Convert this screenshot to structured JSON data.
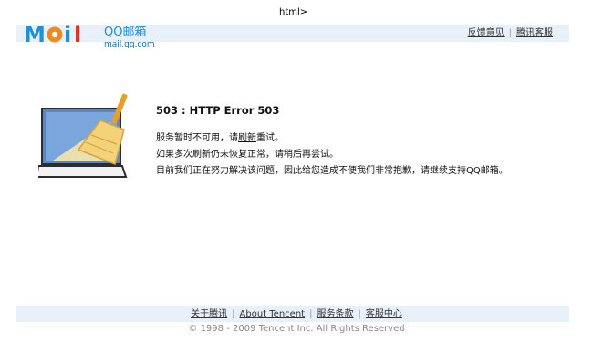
{
  "stray_text": "html>",
  "logo": {
    "word": "MOil",
    "product": "QQ邮箱",
    "domain": "mail.qq.com",
    "colors": {
      "blue": "#1f8fd6",
      "orange": "#f08a1c",
      "red": "#d9342b",
      "domain_text": "#1b6fae"
    }
  },
  "header_links": [
    {
      "label": "反馈意见"
    },
    {
      "label": "腾讯客服"
    }
  ],
  "error": {
    "title": "503 : HTTP Error 503",
    "line1_prefix": "服务暂时不可用，请",
    "line1_link": "刷新",
    "line1_suffix": "重试。",
    "line2": "如果多次刷新仍未恢复正常，请稍后再尝试。",
    "line3": "目前我们正在努力解决该问题，因此给您造成不便我们非常抱歉，请继续支持QQ邮箱。"
  },
  "footer_links": [
    {
      "label": "关于腾讯"
    },
    {
      "label": "About Tencent"
    },
    {
      "label": "服务条款"
    },
    {
      "label": "客服中心"
    }
  ],
  "copyright": "© 1998 - 2009 Tencent Inc. All Rights Reserved",
  "colors": {
    "bar_background": "#e8f0fa",
    "laptop_screen": "#5a86c6",
    "broom_handle": "#e6a02a",
    "broom_head": "#f4d27a"
  }
}
